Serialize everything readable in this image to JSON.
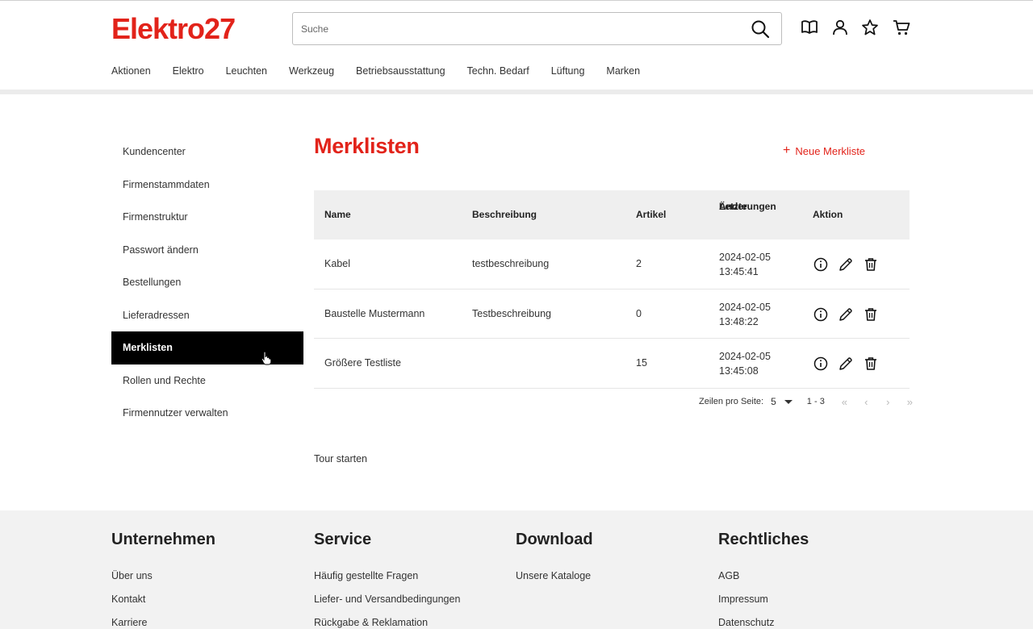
{
  "brand": {
    "name": "Elektro27",
    "accent": "#e2231a"
  },
  "search": {
    "placeholder": "Suche"
  },
  "header_icons": [
    "book-icon",
    "user-icon",
    "star-icon",
    "cart-icon"
  ],
  "nav": [
    "Aktionen",
    "Elektro",
    "Leuchten",
    "Werkzeug",
    "Betriebsausstattung",
    "Techn. Bedarf",
    "Lüftung",
    "Marken"
  ],
  "sidebar": {
    "items": [
      {
        "label": "Kundencenter"
      },
      {
        "label": "Firmenstammdaten"
      },
      {
        "label": "Firmenstruktur"
      },
      {
        "label": "Passwort ändern"
      },
      {
        "label": "Bestellungen"
      },
      {
        "label": "Lieferadressen"
      },
      {
        "label": "Merklisten",
        "active": true
      },
      {
        "label": "Rollen und Rechte"
      },
      {
        "label": "Firmennutzer verwalten"
      }
    ]
  },
  "main": {
    "title": "Merklisten",
    "new_list_label": "Neue Merkliste",
    "table": {
      "headers": {
        "name": "Name",
        "desc": "Beschreibung",
        "artikel": "Artikel",
        "date_line1": "Letzte",
        "date_line2": "Änderungen",
        "aktion": "Aktion"
      },
      "rows": [
        {
          "name": "Kabel",
          "desc": "testbeschreibung",
          "artikel": "2",
          "date": "2024-02-05",
          "time": "13:45:41"
        },
        {
          "name": "Baustelle Mustermann",
          "desc": "Testbeschreibung",
          "artikel": "0",
          "date": "2024-02-05",
          "time": "13:48:22"
        },
        {
          "name": "Größere Testliste",
          "desc": "",
          "artikel": "15",
          "date": "2024-02-05",
          "time": "13:45:08"
        }
      ],
      "row_actions": [
        "info-icon",
        "edit-icon",
        "delete-icon"
      ]
    },
    "pagination": {
      "rows_label": "Zeilen pro Seite:",
      "rows_value": "5",
      "range": "1 - 3",
      "nav": [
        "«",
        "‹",
        "›",
        "»"
      ]
    },
    "tour_label": "Tour starten"
  },
  "footer": {
    "columns": [
      {
        "title": "Unternehmen",
        "links": [
          "Über uns",
          "Kontakt",
          "Karriere"
        ]
      },
      {
        "title": "Service",
        "links": [
          "Häufig gestellte Fragen",
          "Liefer- und Versandbedingungen",
          "Rückgabe & Reklamation"
        ]
      },
      {
        "title": "Download",
        "links": [
          "Unsere Kataloge"
        ]
      },
      {
        "title": "Rechtliches",
        "links": [
          "AGB",
          "Impressum",
          "Datenschutz"
        ]
      }
    ]
  }
}
